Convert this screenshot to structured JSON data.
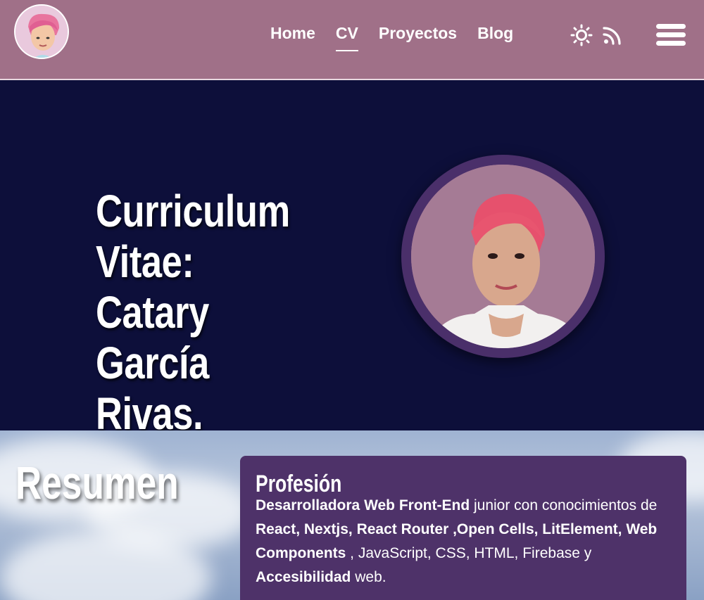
{
  "header": {
    "logo_alt": "avatar-logo",
    "nav": [
      {
        "label": "Home",
        "active": false
      },
      {
        "label": "CV",
        "active": true
      },
      {
        "label": "Proyectos",
        "active": false
      },
      {
        "label": "Blog",
        "active": false
      }
    ],
    "icons": [
      "sun-icon",
      "rss-icon",
      "hamburger-menu-icon"
    ]
  },
  "hero": {
    "title_line1": "Curriculum",
    "title_line2": "Vitae: Catary",
    "title_line3": "García Rivas.",
    "portrait": "portrait-photo"
  },
  "resumen": {
    "title": "Resumen",
    "card": {
      "heading": "Profesión",
      "role": "Desarrolladora Web Front-End",
      "text1": " junior con conocimientos de ",
      "skills_bold_1": "React, Nextjs, React Router ,Open Cells, LitElement, Web Components",
      "text2": " , JavaScript, CSS, HTML, Firebase y ",
      "skills_bold_2": "Accesibilidad",
      "text3": " web."
    }
  },
  "colors": {
    "header_bg": "#a07088",
    "hero_bg": "#0d0f3a",
    "card_bg": "#4e3269",
    "portrait_ring": "#4a2f6a"
  }
}
